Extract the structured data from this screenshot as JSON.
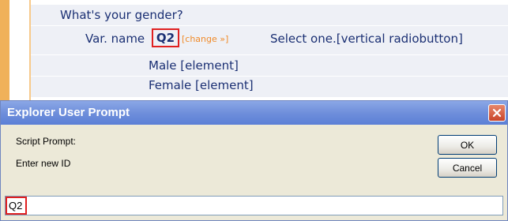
{
  "survey": {
    "question_text": "What's your gender?",
    "var_label": "Var. name",
    "var_code": "Q2",
    "change_link": "[change »]",
    "select_text": "Select one.[vertical radiobutton]",
    "elements": [
      "Male [element]",
      "Female [element]"
    ]
  },
  "dialog": {
    "title": "Explorer User Prompt",
    "script_prompt_label": "Script Prompt:",
    "enter_label": "Enter new ID",
    "ok_label": "OK",
    "cancel_label": "Cancel",
    "input_value": "Q2"
  },
  "colors": {
    "highlight_border": "#e02020",
    "survey_text": "#1a2f73",
    "change_link": "#f08b2a",
    "titlebar": "#6f8fdb",
    "dialog_bg": "#ece9d8"
  },
  "icons": {
    "close": "close-icon"
  }
}
